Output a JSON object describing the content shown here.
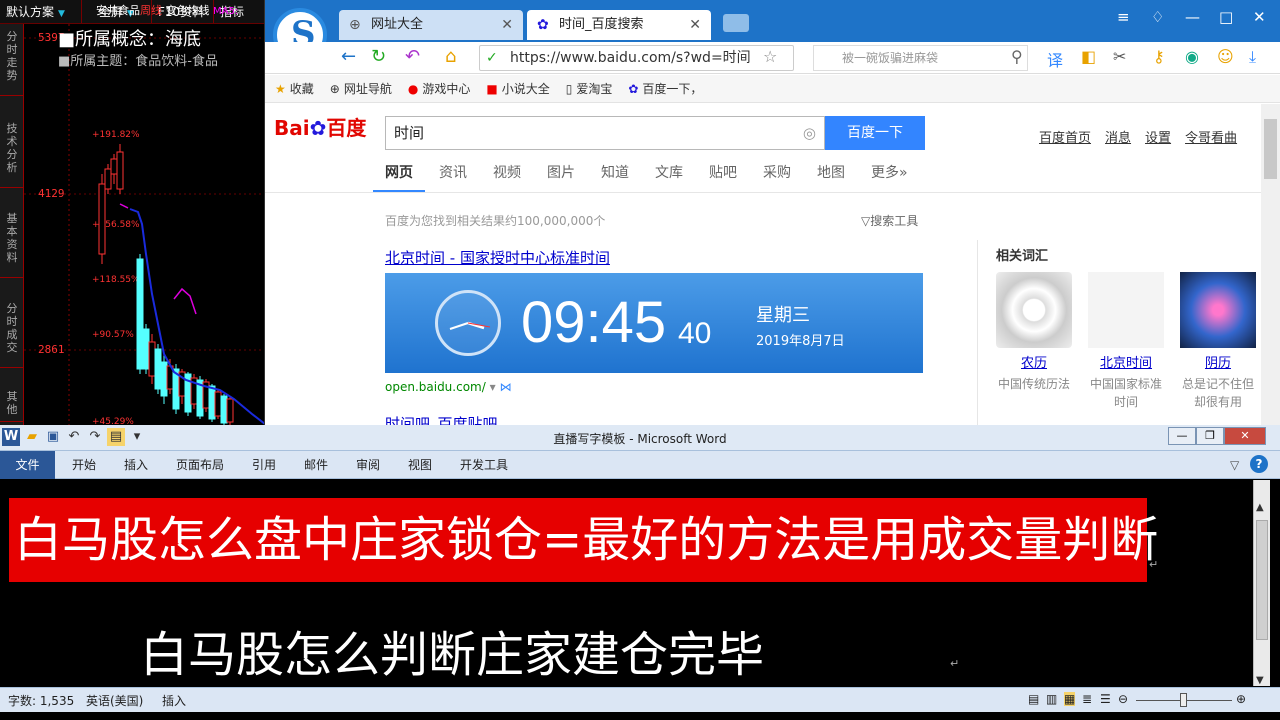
{
  "stock": {
    "tabs": [
      "默认方案",
      "全屏",
      "F10资料",
      "指标"
    ],
    "sidebar": [
      "分时走势",
      "技术分析",
      "基本资料",
      "分时成交",
      "其他"
    ],
    "prices": [
      "5397",
      "4129",
      "2861"
    ],
    "pct_labels": [
      "+191.82%",
      "+156.58%",
      "+118.55%",
      "+90.57%",
      "+45.29%"
    ],
    "stock_name": "安井食品",
    "stock_extra": "周线",
    "ma_label": "变色均线",
    "ma_value": "MA5:",
    "concept_label": "■所属概念：海底",
    "theme_label": "■所属主题：食品饮料-食品"
  },
  "browser": {
    "tabs": [
      {
        "label": "网址大全",
        "active": false
      },
      {
        "label": "时间_百度搜索",
        "active": true
      }
    ],
    "address": "https://www.baidu.com/s?wd=时间",
    "side_search_placeholder": "被一碗饭骗进麻袋",
    "favorites": [
      "收藏",
      "网址导航",
      "游戏中心",
      "小说大全",
      "爱淘宝",
      "百度一下，"
    ],
    "colors": {
      "titlebar": "#1e73c8",
      "search_btn": "#3385ff"
    }
  },
  "baidu": {
    "logo_text": "Bai",
    "logo_suffix": "百度",
    "query": "时间",
    "search_button": "百度一下",
    "top_links": [
      "百度首页",
      "消息",
      "设置",
      "令哥看曲"
    ],
    "tabs": [
      "网页",
      "资讯",
      "视频",
      "图片",
      "知道",
      "文库",
      "贴吧",
      "采购",
      "地图",
      "更多»"
    ],
    "result_count": "百度为您找到相关结果约100,000,000个",
    "search_tools": "搜索工具",
    "result1_title": "北京时间 - 国家授时中心标准时间",
    "clock": {
      "time": "09:45",
      "seconds": "40",
      "weekday": "星期三",
      "date": "2019年8月7日"
    },
    "result1_url": "open.baidu.com/",
    "result2_title": "时间吧_百度贴吧",
    "related_title": "相关词汇",
    "related": [
      {
        "name": "农历",
        "desc": "中国传统历法"
      },
      {
        "name": "北京时间",
        "desc": "中国国家标准时间"
      },
      {
        "name": "阴历",
        "desc": "总是记不住但却很有用"
      }
    ]
  },
  "word": {
    "title": "直播写字模板 - Microsoft Word",
    "ribbon_tabs": [
      "文件",
      "开始",
      "插入",
      "页面布局",
      "引用",
      "邮件",
      "审阅",
      "视图",
      "开发工具"
    ],
    "line1": "白马股怎么盘中庄家锁仓=最好的方法是用成交量判断",
    "line2": "白马股怎么判断庄家建仓完毕",
    "status_words": "字数: 1,535",
    "status_lang": "英语(美国)",
    "status_mode": "插入"
  }
}
